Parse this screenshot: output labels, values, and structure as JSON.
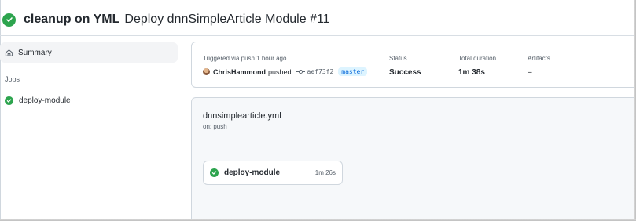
{
  "header": {
    "title_bold": "cleanup on YML",
    "title_rest": "Deploy dnnSimpleArticle Module #11",
    "status_icon": "check-circle-fill-icon"
  },
  "sidebar": {
    "summary_label": "Summary",
    "summary_icon": "home-icon",
    "jobs_heading": "Jobs",
    "jobs": [
      {
        "label": "deploy-module",
        "icon": "check-circle-fill-icon"
      }
    ]
  },
  "summary": {
    "trigger_label": "Triggered via push 1 hour ago",
    "actor": "ChrisHammond",
    "action": "pushed",
    "commit_sha": "aef73f2",
    "branch": "master",
    "status_label": "Status",
    "status_value": "Success",
    "duration_label": "Total duration",
    "duration_value": "1m 38s",
    "artifacts_label": "Artifacts",
    "artifacts_value": "–"
  },
  "workflow": {
    "file_name": "dnnsimplearticle.yml",
    "trigger": "on: push",
    "job_name": "deploy-module",
    "job_duration": "1m 26s"
  },
  "colors": {
    "success": "#2da44e",
    "link": "#0969da",
    "branch_bg": "#ddf4ff"
  }
}
